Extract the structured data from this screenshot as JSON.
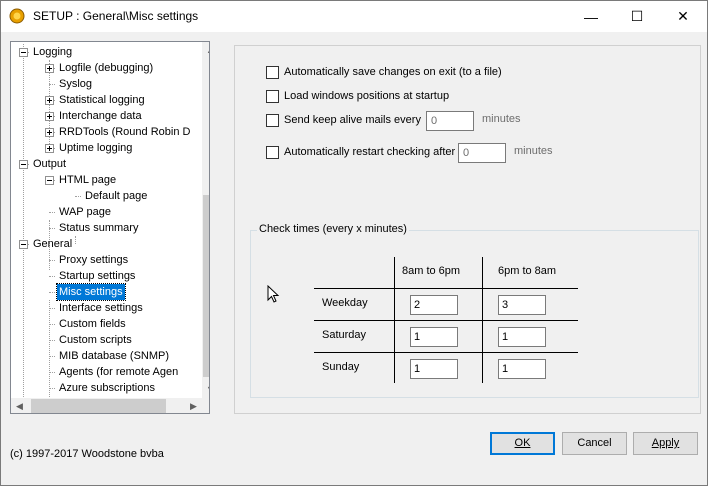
{
  "window": {
    "title": "SETUP : General\\Misc settings",
    "minimize_glyph": "—",
    "maximize_glyph": "☐",
    "close_glyph": "✕"
  },
  "tree": {
    "items": [
      {
        "label": "Logging",
        "level": 0,
        "expander": "minus"
      },
      {
        "label": "Logfile (debugging)",
        "level": 1,
        "expander": "plus"
      },
      {
        "label": "Syslog",
        "level": 1,
        "expander": "none"
      },
      {
        "label": "Statistical logging",
        "level": 1,
        "expander": "plus"
      },
      {
        "label": "Interchange data",
        "level": 1,
        "expander": "plus"
      },
      {
        "label": "RRDTools (Round Robin D",
        "level": 1,
        "expander": "plus"
      },
      {
        "label": "Uptime logging",
        "level": 1,
        "expander": "plus"
      },
      {
        "label": "Output",
        "level": 0,
        "expander": "minus"
      },
      {
        "label": "HTML page",
        "level": 1,
        "expander": "minus"
      },
      {
        "label": "Default page",
        "level": 2,
        "expander": "none"
      },
      {
        "label": "WAP page",
        "level": 1,
        "expander": "none"
      },
      {
        "label": "Status summary",
        "level": 1,
        "expander": "none"
      },
      {
        "label": "General",
        "level": 0,
        "expander": "minus"
      },
      {
        "label": "Proxy settings",
        "level": 1,
        "expander": "none"
      },
      {
        "label": "Startup settings",
        "level": 1,
        "expander": "none"
      },
      {
        "label": "Misc settings",
        "level": 1,
        "expander": "none",
        "selected": true
      },
      {
        "label": "Interface settings",
        "level": 1,
        "expander": "none"
      },
      {
        "label": "Custom fields",
        "level": 1,
        "expander": "none"
      },
      {
        "label": "Custom scripts",
        "level": 1,
        "expander": "none"
      },
      {
        "label": "MIB database (SNMP)",
        "level": 1,
        "expander": "none"
      },
      {
        "label": "Agents (for remote Agen",
        "level": 1,
        "expander": "none"
      },
      {
        "label": "Azure subscriptions",
        "level": 1,
        "expander": "none"
      }
    ]
  },
  "options": {
    "autosave": {
      "label": "Automatically save changes on exit (to a file)",
      "checked": false
    },
    "load_positions": {
      "label": "Load windows positions at startup",
      "checked": false
    },
    "keepalive": {
      "label": "Send keep alive mails every",
      "checked": false,
      "value": "0",
      "unit": "minutes"
    },
    "restart": {
      "label": "Automatically restart checking after",
      "checked": false,
      "value": "0",
      "unit": "minutes"
    }
  },
  "check_times": {
    "title": "Check times (every x minutes)",
    "columns": [
      "8am to 6pm",
      "6pm to 8am"
    ],
    "rows": [
      {
        "label": "Weekday",
        "values": [
          "2",
          "3"
        ]
      },
      {
        "label": "Saturday",
        "values": [
          "1",
          "1"
        ]
      },
      {
        "label": "Sunday",
        "values": [
          "1",
          "1"
        ]
      }
    ]
  },
  "footer": {
    "copyright": "(c) 1997-2017 Woodstone bvba",
    "ok_label": "OK",
    "cancel_label": "Cancel",
    "apply_label": "Apply"
  },
  "colors": {
    "selection": "#0078d7",
    "window_bg": "#f0f0f0"
  }
}
